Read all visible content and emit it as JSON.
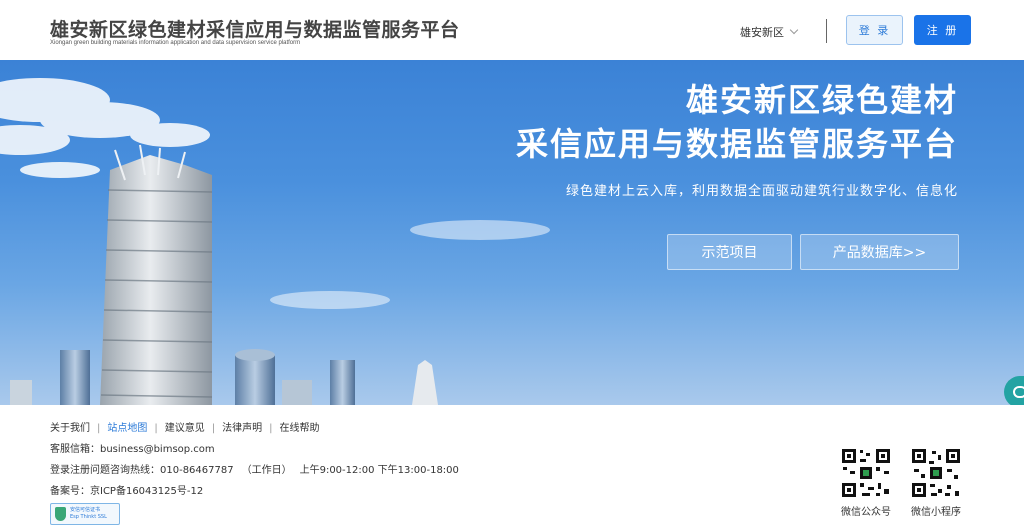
{
  "header": {
    "title": "雄安新区绿色建材采信应用与数据监管服务平台",
    "subtitle": "Xiongan green building materials information application and data supervision service platform",
    "region": "雄安新区",
    "login_label": "登 录",
    "register_label": "注 册"
  },
  "hero": {
    "title_line1": "雄安新区绿色建材",
    "title_line2": "采信应用与数据监管服务平台",
    "slogan": "绿色建材上云入库，利用数据全面驱动建筑行业数字化、信息化",
    "btn_demo": "示范项目",
    "btn_db": "产品数据库>>"
  },
  "footer": {
    "links": [
      "关于我们",
      "站点地图",
      "建议意见",
      "法律声明",
      "在线帮助"
    ],
    "email_label": "客服信箱：",
    "email": "business@bimsop.com",
    "hotline_label": "登录注册问题咨询热线：",
    "hotline": "010-86467787",
    "workday": "（工作日）",
    "hours": "上午9:00-12:00 下午13:00-18:00",
    "icp_label": "备案号：",
    "icp": "京ICP备16043125号-12",
    "badge_line1": "安信可信证书",
    "badge_line2": "Esp Thinkt SSL",
    "qr1_label": "微信公众号",
    "qr2_label": "微信小程序"
  },
  "colors": {
    "primary": "#1a73e8",
    "hero_sky": "#4a90dd",
    "chat": "#23a3a3"
  }
}
